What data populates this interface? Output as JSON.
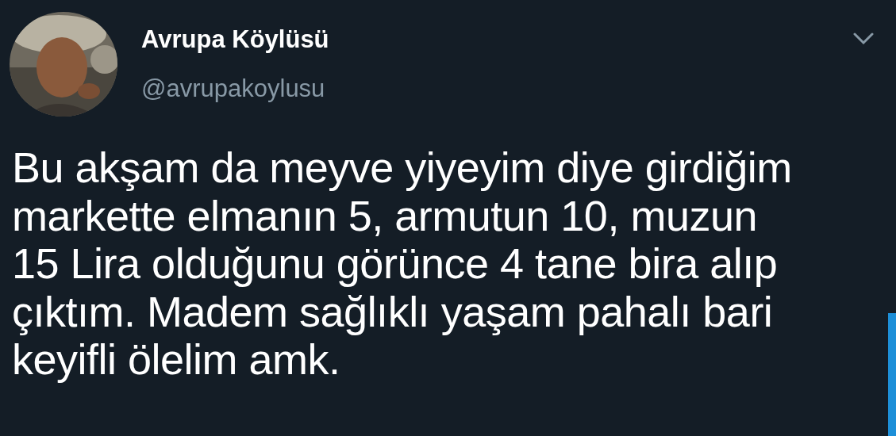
{
  "tweet": {
    "display_name": "Avrupa Köylüsü",
    "handle": "@avrupakoylusu",
    "text": "Bu akşam da meyve yiyeyim diye girdiğim\nmarkette elmanın 5, armutun 10, muzun\n15 Lira olduğunu görünce 4 tane bira alıp\nçıktım. Madem sağlıklı yaşam pahalı bari\nkeyifli ölelim amk."
  }
}
